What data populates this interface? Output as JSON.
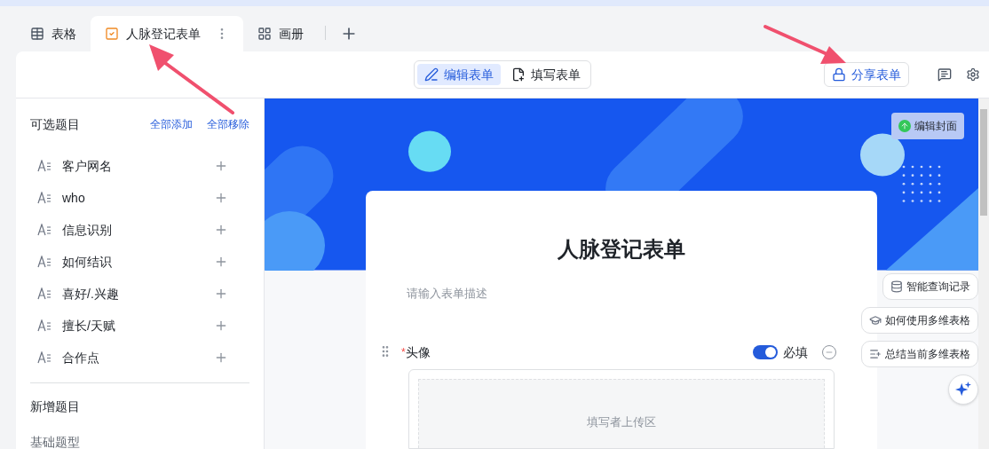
{
  "tabs": [
    {
      "label": "表格",
      "selected": false
    },
    {
      "label": "人脉登记表单",
      "selected": true
    },
    {
      "label": "画册",
      "selected": false
    }
  ],
  "mode_switch": [
    {
      "label": "编辑表单",
      "selected": true
    },
    {
      "label": "填写表单",
      "selected": false
    }
  ],
  "share_button": "分享表单",
  "sidebar": {
    "title": "可选题目",
    "add_all": "全部添加",
    "remove_all": "全部移除",
    "items": [
      {
        "label": "客户网名"
      },
      {
        "label": "who"
      },
      {
        "label": "信息识别"
      },
      {
        "label": "如何结识"
      },
      {
        "label": "喜好/.兴趣"
      },
      {
        "label": "擅长/天赋"
      },
      {
        "label": "合作点"
      }
    ],
    "new_section": "新增题目",
    "basic_types": "基础题型"
  },
  "cover_button": "编辑封面",
  "form": {
    "title": "人脉登记表单",
    "description_placeholder": "请输入表单描述",
    "fields": [
      {
        "label": "头像",
        "required_mark": "*",
        "required": true,
        "required_label": "必填",
        "upload_hint": "填写者上传区"
      }
    ]
  },
  "assistant": [
    {
      "label": "智能查询记录"
    },
    {
      "label": "如何使用多维表格"
    },
    {
      "label": "总结当前多维表格"
    }
  ]
}
